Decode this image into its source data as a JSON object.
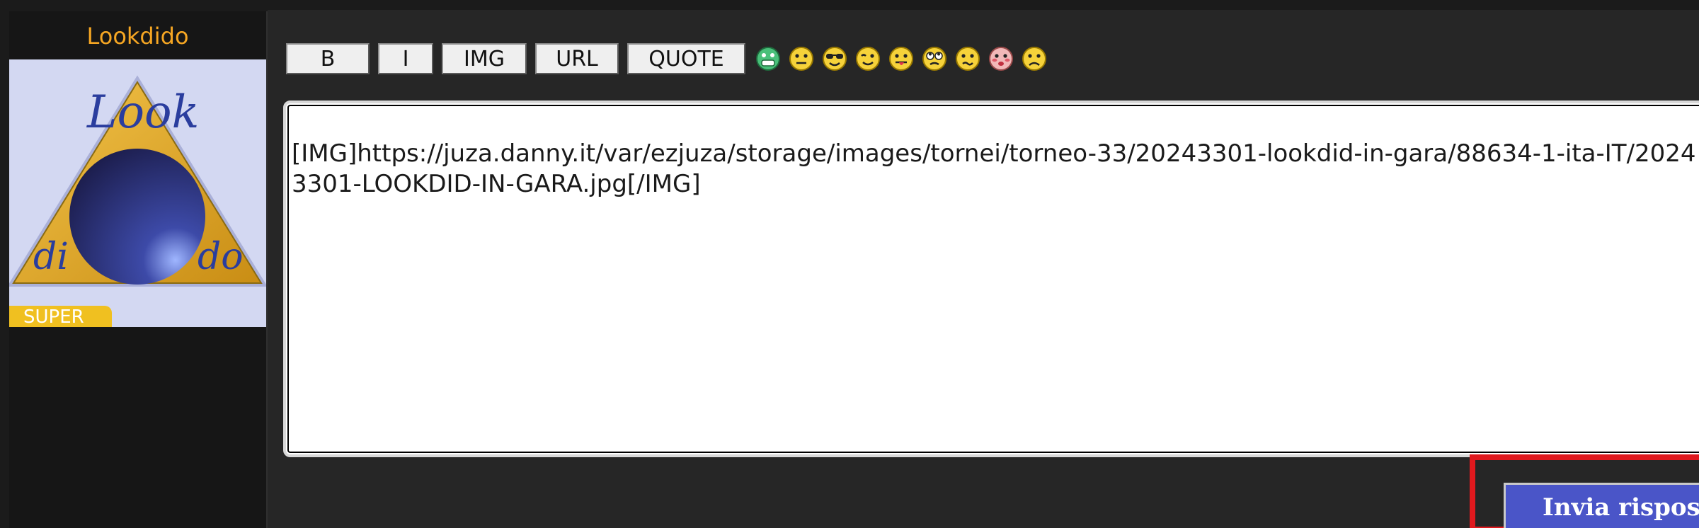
{
  "user": {
    "username": "Lookdido",
    "badge": "SUPER",
    "avatar_text": {
      "top": "Look",
      "bottom_left": "di",
      "bottom_right": "do"
    }
  },
  "toolbar": {
    "buttons": [
      "B",
      "I",
      "IMG",
      "URL",
      "QUOTE"
    ],
    "smilies": [
      "grin-icon",
      "neutral-face-icon",
      "cool-sunglasses-icon",
      "wink-icon",
      "tongue-out-icon",
      "eye-roll-icon",
      "confused-icon",
      "blush-icon",
      "sad-icon"
    ]
  },
  "editor": {
    "value": "[IMG]https://juza.danny.it/var/ezjuza/storage/images/tornei/torneo-33/20243301-lookdid-in-gara/88634-1-ita-IT/20243301-LOOKDID-IN-GARA.jpg[/IMG]"
  },
  "submit": {
    "label": "Invia risposta"
  },
  "colors": {
    "username": "#f5a623",
    "badge": "#f0c020",
    "submit_bg": "#4a55c8",
    "highlight": "#e0191e"
  }
}
